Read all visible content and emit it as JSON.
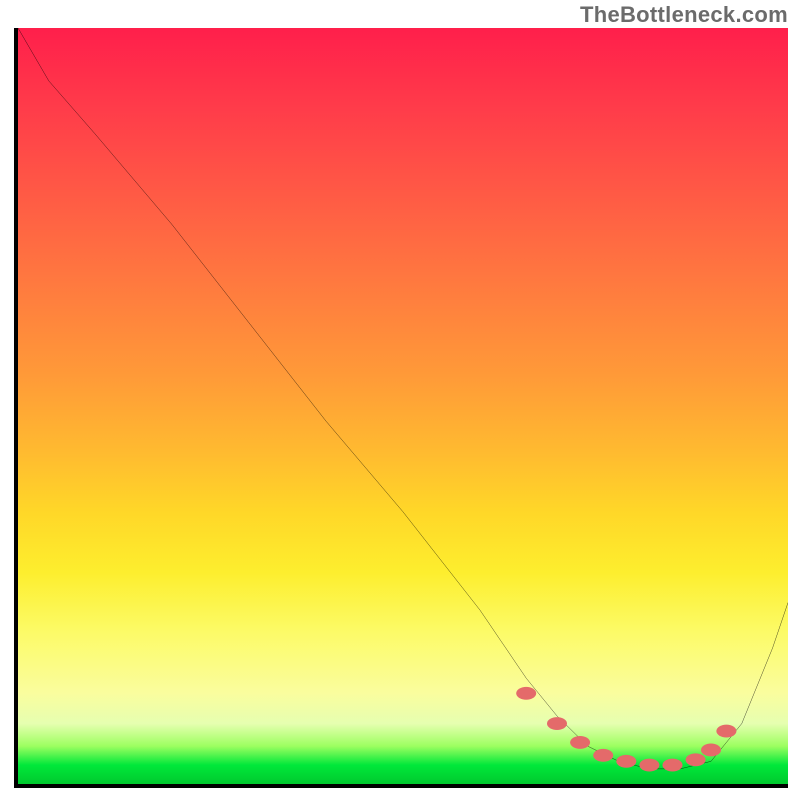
{
  "watermark": "TheBottleneck.com",
  "chart_data": {
    "type": "line",
    "title": "",
    "xlabel": "",
    "ylabel": "",
    "xlim": [
      0,
      100
    ],
    "ylim": [
      0,
      100
    ],
    "grid": false,
    "legend": false,
    "series": [
      {
        "name": "bottleneck-curve",
        "color": "#000000",
        "x": [
          0,
          4,
          10,
          20,
          30,
          40,
          50,
          60,
          66,
          70,
          74,
          78,
          82,
          86,
          90,
          94,
          98,
          100
        ],
        "y": [
          100,
          93,
          86,
          74,
          61,
          48,
          36,
          23,
          14,
          9,
          5,
          3,
          2,
          2,
          3,
          8,
          18,
          24
        ]
      }
    ],
    "markers": {
      "name": "flat-bottom-markers",
      "color": "#e46a6a",
      "x": [
        66,
        70,
        73,
        76,
        79,
        82,
        85,
        88,
        90,
        92
      ],
      "y": [
        12,
        8,
        5.5,
        3.8,
        3.0,
        2.5,
        2.5,
        3.2,
        4.5,
        7
      ]
    },
    "gradient_stops": [
      {
        "pos": 0.0,
        "color": "#ff1f4b"
      },
      {
        "pos": 0.1,
        "color": "#ff3a4a"
      },
      {
        "pos": 0.22,
        "color": "#ff5a45"
      },
      {
        "pos": 0.34,
        "color": "#ff7a3f"
      },
      {
        "pos": 0.46,
        "color": "#ff9a38"
      },
      {
        "pos": 0.56,
        "color": "#ffba30"
      },
      {
        "pos": 0.64,
        "color": "#ffd728"
      },
      {
        "pos": 0.72,
        "color": "#fdee2e"
      },
      {
        "pos": 0.8,
        "color": "#fcfb68"
      },
      {
        "pos": 0.88,
        "color": "#fafd9e"
      },
      {
        "pos": 0.92,
        "color": "#e6ffb0"
      },
      {
        "pos": 0.95,
        "color": "#9cff60"
      },
      {
        "pos": 0.975,
        "color": "#00e83a"
      },
      {
        "pos": 1.0,
        "color": "#00c92e"
      }
    ]
  }
}
